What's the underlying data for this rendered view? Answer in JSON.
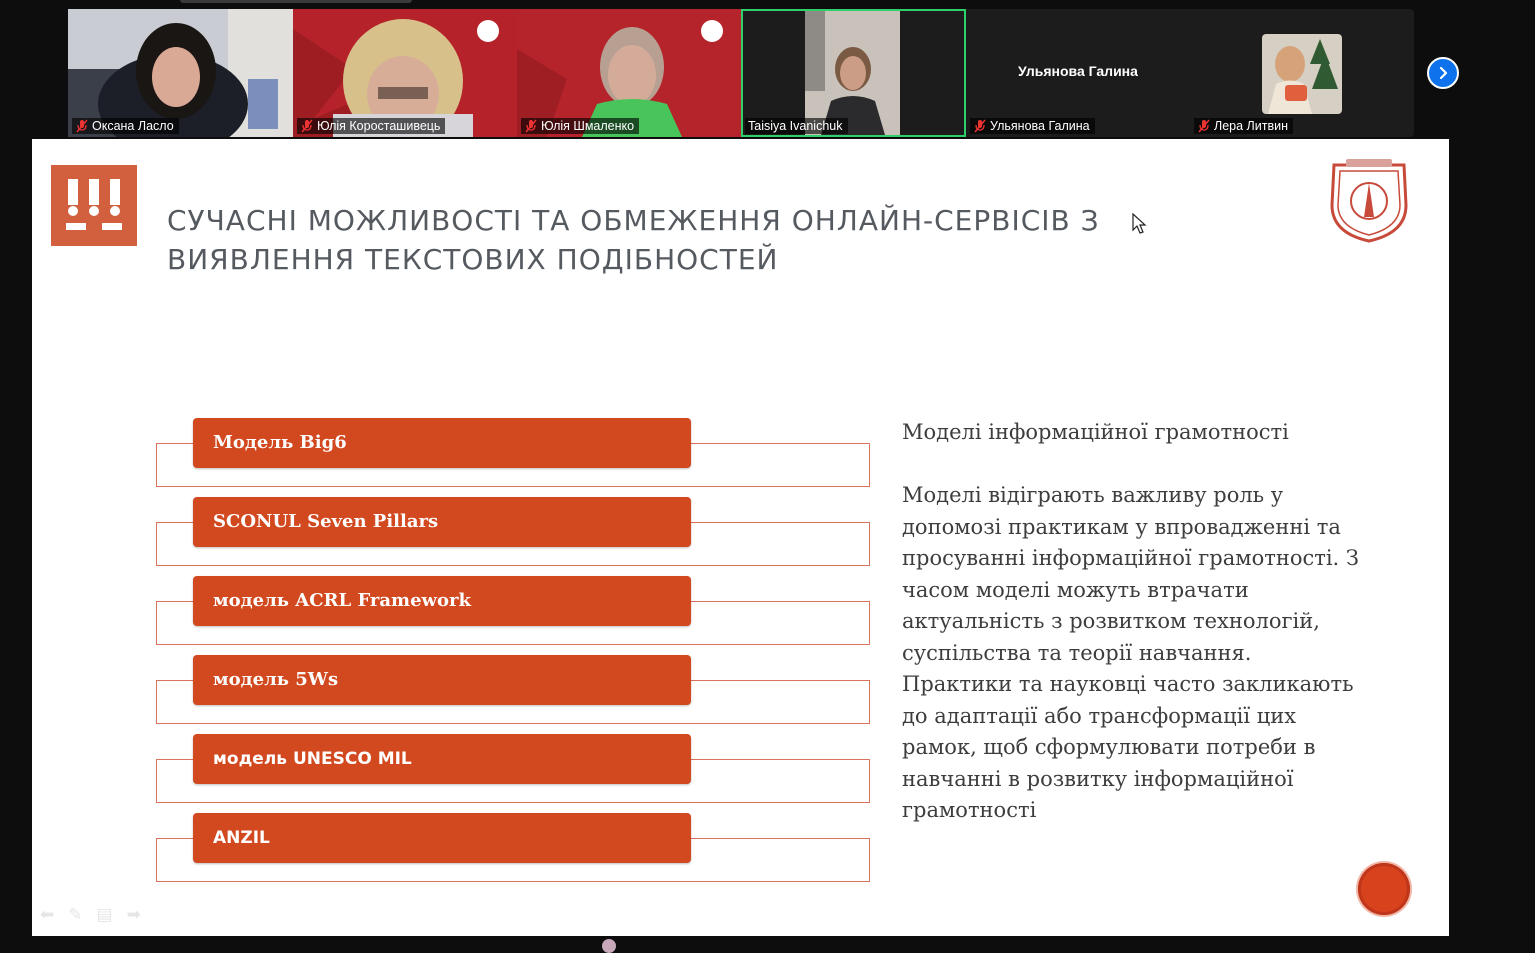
{
  "participants": [
    {
      "name": "Оксана Ласло",
      "muted": true
    },
    {
      "name": "Юлія Короcташивець",
      "muted": true
    },
    {
      "name": "Юлія Шмаленко",
      "muted": true
    },
    {
      "name": "Taisiya Ivanichuk",
      "muted": false,
      "active_speaker": true
    },
    {
      "name": "Ульянова Галина",
      "muted": true,
      "video": false,
      "display_name": "Ульянова Галина"
    },
    {
      "name": "Лера Литвин",
      "muted": true
    }
  ],
  "slide": {
    "title_line1": "СУЧАСНІ МОЖЛИВОСТІ ТА ОБМЕЖЕННЯ ОНЛАЙН-СЕРВІСІВ З",
    "title_line2": "ВИЯВЛЕННЯ ТЕКСТОВИХ ПОДІБНОСТЕЙ",
    "models": [
      "Модель Big6",
      "SCONUL Seven Pillars",
      "модель ACRL Framework",
      "модель 5Ws",
      "модель UNESCO MIL",
      "ANZIL"
    ],
    "body_heading": "Моделі інформаційної грамотності",
    "body_text": "Моделі відіграють важливу роль у допомозі практикам у впровадженні та просуванні інформаційної грамотності. З часом моделі можуть втрачати актуальність з розвитком технологій, суспільства та теорії навчання. Практики та науковці часто закликають до адаптації або трансформації цих рамок, щоб сформулювати потреби в навчанні в розвитку інформаційної грамотності"
  },
  "colors": {
    "accent": "#d2491f",
    "logo": "#d2603f",
    "title": "#555a60",
    "active_speaker": "#2fd06c",
    "next_button": "#0e72ed"
  },
  "icons": [
    "mic-off-icon",
    "chevron-right-icon",
    "arrow-left-icon",
    "pen-icon",
    "menu-icon",
    "arrow-right-icon"
  ]
}
